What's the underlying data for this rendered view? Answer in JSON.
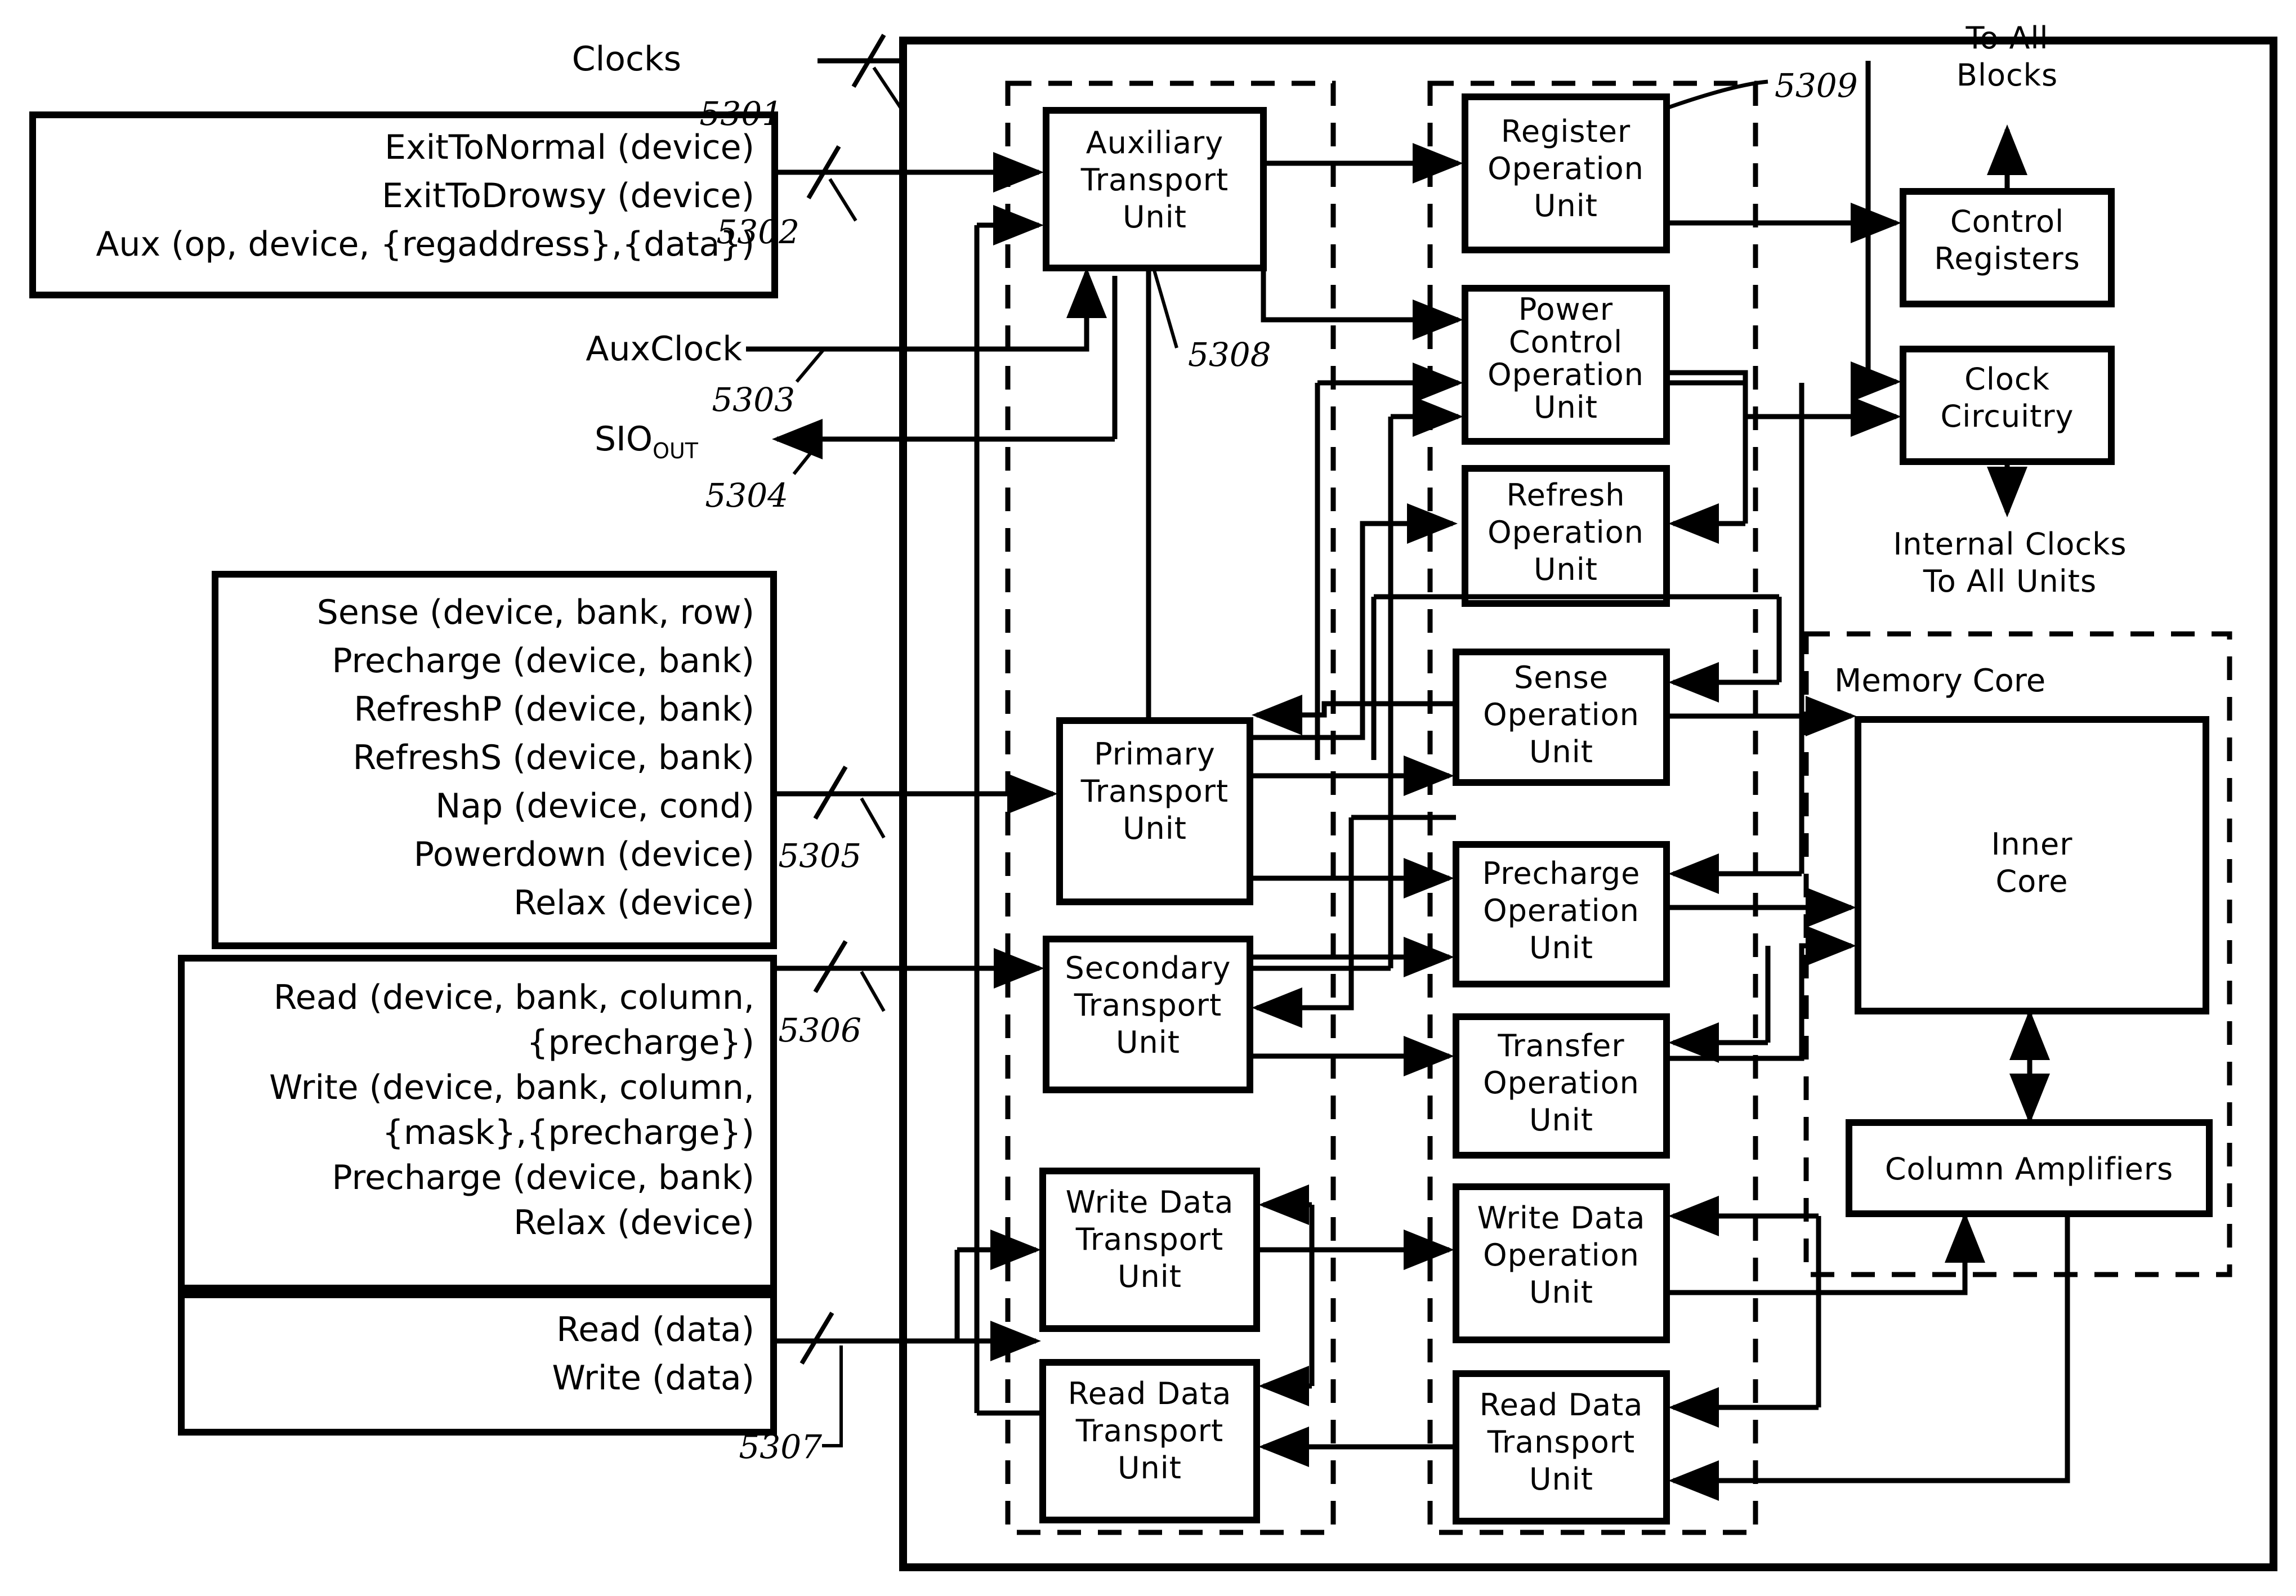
{
  "figure": {
    "type": "block-diagram",
    "title_text": null,
    "outer_frame": "device boundary (solid rectangle)"
  },
  "external_signals": [
    {
      "name": "clocks",
      "label": "Clocks",
      "ref": "5301",
      "slash": true,
      "direction": "in"
    },
    {
      "name": "aux-clock",
      "label": "AuxClock",
      "ref": "5303",
      "slash": false,
      "direction": "in"
    },
    {
      "name": "sio-out",
      "label": "SIO",
      "subscript": "OUT",
      "ref": "5304",
      "slash": false,
      "direction": "out"
    }
  ],
  "command_boxes": [
    {
      "name": "aux-command-box",
      "ref": "5302",
      "slash": true,
      "lines": [
        "ExitToNormal (device)",
        "ExitToDrowsy (device)",
        "Aux (op, device, {regaddress},{data})"
      ]
    },
    {
      "name": "primary-command-box",
      "ref": "5305",
      "slash": true,
      "lines": [
        "Sense (device, bank, row)",
        "Precharge (device, bank)",
        "RefreshP (device, bank)",
        "RefreshS (device, bank)",
        "Nap (device, cond)",
        "Powerdown (device)",
        "Relax (device)"
      ]
    },
    {
      "name": "secondary-command-box",
      "ref": "5306",
      "slash": true,
      "lines": [
        "Read (device, bank, column,",
        "{precharge})",
        "Write (device, bank, column,",
        "{mask},{precharge})",
        "Precharge (device, bank)",
        "Relax (device)"
      ]
    },
    {
      "name": "data-command-box",
      "ref": "5307",
      "slash": true,
      "lines": [
        "Read (data)",
        "Write (data)"
      ]
    }
  ],
  "transport_group": {
    "name": "transport-units-group",
    "ref": "5308",
    "units": [
      {
        "name": "auxiliary-transport-unit",
        "lines": [
          "Auxiliary",
          "Transport",
          "Unit"
        ]
      },
      {
        "name": "primary-transport-unit",
        "lines": [
          "Primary",
          "Transport",
          "Unit"
        ]
      },
      {
        "name": "secondary-transport-unit",
        "lines": [
          "Secondary",
          "Transport",
          "Unit"
        ]
      },
      {
        "name": "write-data-transport-unit",
        "lines": [
          "Write Data",
          "Transport",
          "Unit"
        ]
      },
      {
        "name": "read-data-transport-unit",
        "lines": [
          "Read Data",
          "Transport",
          "Unit"
        ]
      }
    ]
  },
  "operation_group": {
    "name": "operation-units-group",
    "ref": "5309",
    "units": [
      {
        "name": "register-operation-unit",
        "lines": [
          "Register",
          "Operation",
          "Unit"
        ]
      },
      {
        "name": "power-control-operation-unit",
        "lines": [
          "Power",
          "Control",
          "Operation",
          "Unit"
        ]
      },
      {
        "name": "refresh-operation-unit",
        "lines": [
          "Refresh",
          "Operation",
          "Unit"
        ]
      },
      {
        "name": "sense-operation-unit",
        "lines": [
          "Sense",
          "Operation",
          "Unit"
        ]
      },
      {
        "name": "precharge-operation-unit",
        "lines": [
          "Precharge",
          "Operation",
          "Unit"
        ]
      },
      {
        "name": "transfer-operation-unit",
        "lines": [
          "Transfer",
          "Operation",
          "Unit"
        ]
      },
      {
        "name": "write-data-operation-unit",
        "lines": [
          "Write Data",
          "Operation",
          "Unit"
        ]
      },
      {
        "name": "read-data-transport-unit-right",
        "lines": [
          "Read Data",
          "Transport",
          "Unit"
        ]
      }
    ]
  },
  "right_blocks": [
    {
      "name": "control-registers",
      "lines": [
        "Control",
        "Registers"
      ]
    },
    {
      "name": "clock-circuitry",
      "lines": [
        "Clock",
        "Circuitry"
      ]
    }
  ],
  "memory_core": {
    "name": "memory-core-group",
    "title": "Memory Core",
    "blocks": [
      {
        "name": "inner-core",
        "lines": [
          "Inner",
          "Core"
        ]
      },
      {
        "name": "column-amplifiers",
        "lines": [
          "Column Amplifiers"
        ]
      }
    ]
  },
  "annotations": [
    {
      "name": "to-all-blocks-label",
      "lines": [
        "To All",
        "Blocks"
      ]
    },
    {
      "name": "internal-clocks-label",
      "lines": [
        "Internal Clocks",
        "To All Units"
      ]
    }
  ],
  "colors": {
    "ink": "#000000",
    "paper": "#ffffff"
  }
}
